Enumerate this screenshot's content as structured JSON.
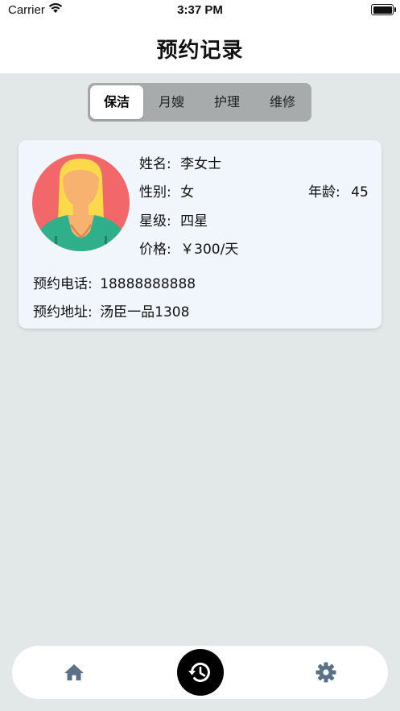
{
  "status_bar": {
    "carrier": "Carrier",
    "time": "3:37 PM"
  },
  "nav": {
    "title": "预约记录"
  },
  "tabs": [
    {
      "label": "保洁",
      "active": true
    },
    {
      "label": "月嫂",
      "active": false
    },
    {
      "label": "护理",
      "active": false
    },
    {
      "label": "维修",
      "active": false
    }
  ],
  "record": {
    "name_label": "姓名:",
    "name": "李女士",
    "gender_label": "性别:",
    "gender": "女",
    "age_label": "年龄:",
    "age": "45",
    "level_label": "星级:",
    "level": "四星",
    "price_label": "价格:",
    "price": "￥300/天",
    "phone_label": "预约电话:",
    "phone": "18888888888",
    "address_label": "预约地址:",
    "address": "汤臣一品1308"
  },
  "bottom_tabs": {
    "home_icon": "home-icon",
    "history_icon": "history-icon",
    "settings_icon": "gear-icon"
  },
  "colors": {
    "background": "#e2e8e8",
    "card": "#f0f6fc",
    "segment_bg": "#a7abab",
    "icon": "#5a7186",
    "history_button": "#000000"
  }
}
